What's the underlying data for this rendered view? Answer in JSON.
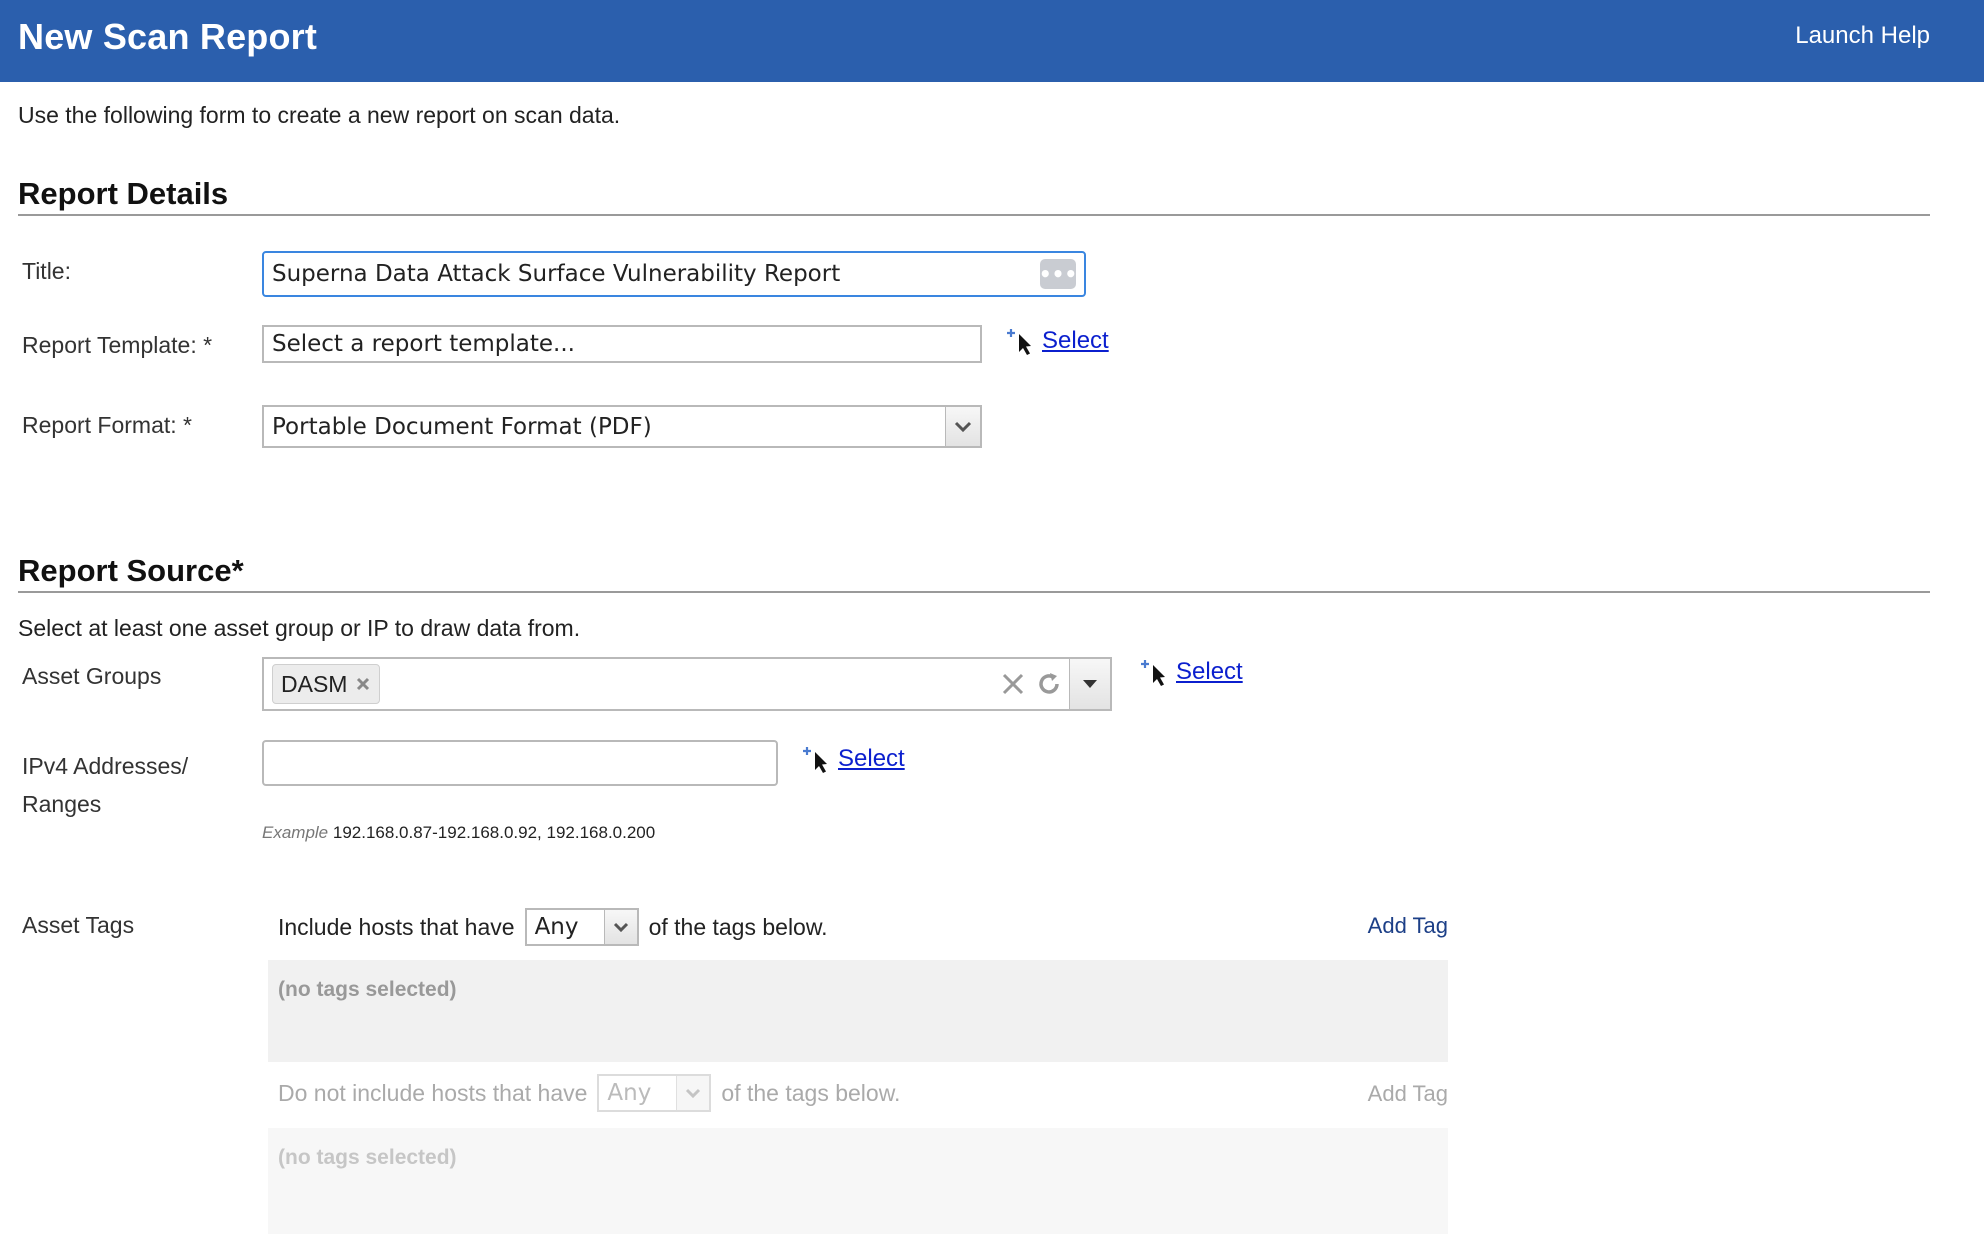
{
  "header": {
    "title": "New Scan Report",
    "help_label": "Launch Help"
  },
  "intro": "Use the following form to create a new report on scan data.",
  "report_details": {
    "heading": "Report Details",
    "title_label": "Title:",
    "title_value": "Superna Data Attack Surface Vulnerability Report",
    "template_label": "Report Template: *",
    "template_placeholder": "Select a report template...",
    "template_select": "Select",
    "format_label": "Report Format: *",
    "format_value": "Portable Document Format (PDF)"
  },
  "report_source": {
    "heading": "Report Source*",
    "description": "Select at least one asset group or IP to draw data from.",
    "asset_groups_label": "Asset Groups",
    "asset_group_chips": [
      "DASM"
    ],
    "asset_groups_select": "Select",
    "ipv4_label_line1": "IPv4 Addresses/",
    "ipv4_label_line2": "Ranges",
    "ipv4_value": "",
    "ipv4_select": "Select",
    "example_prefix": "Example",
    "example_value": "192.168.0.87-192.168.0.92, 192.168.0.200",
    "asset_tags_label": "Asset Tags",
    "include": {
      "prefix": "Include hosts that have",
      "match": "Any",
      "suffix": "of the tags below.",
      "add_tag": "Add Tag",
      "empty": "(no tags selected)"
    },
    "exclude": {
      "prefix": "Do not include hosts that have",
      "match": "Any",
      "suffix": "of the tags below.",
      "add_tag": "Add Tag",
      "empty": "(no tags selected)"
    }
  },
  "colors": {
    "header_bg": "#2b5fad",
    "link": "#0b1fce",
    "focus_border": "#3a86e0"
  },
  "icons": [
    "more-dots-icon",
    "add-select-cursor-icon",
    "chevron-down-icon",
    "clear-x-icon",
    "refresh-icon",
    "caret-down-icon",
    "chip-remove-icon"
  ]
}
